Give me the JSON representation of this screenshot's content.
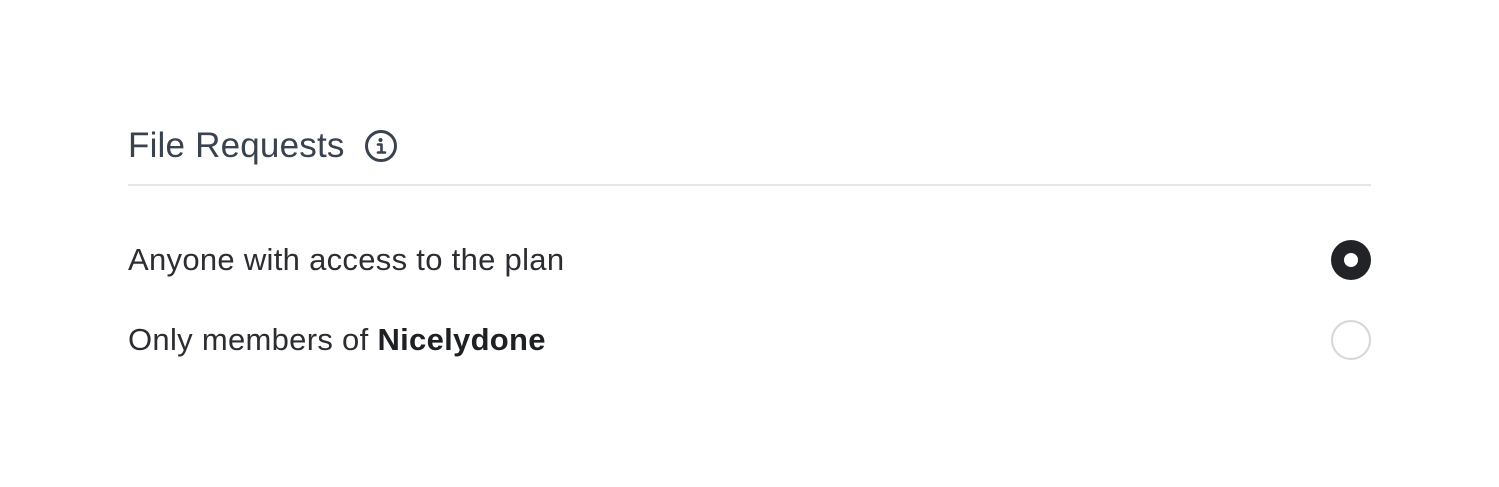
{
  "section": {
    "title": "File Requests",
    "info_icon": "info-circle-icon"
  },
  "options": [
    {
      "label": "Anyone with access to the plan",
      "selected": true
    },
    {
      "label_prefix": "Only members of ",
      "label_bold": "Nicelydone",
      "selected": false
    }
  ],
  "colors": {
    "title": "#3a4250",
    "text": "#2b2d31",
    "divider": "#e3e5e8",
    "radio_checked": "#222326",
    "radio_unchecked_border": "#d4d6da"
  }
}
